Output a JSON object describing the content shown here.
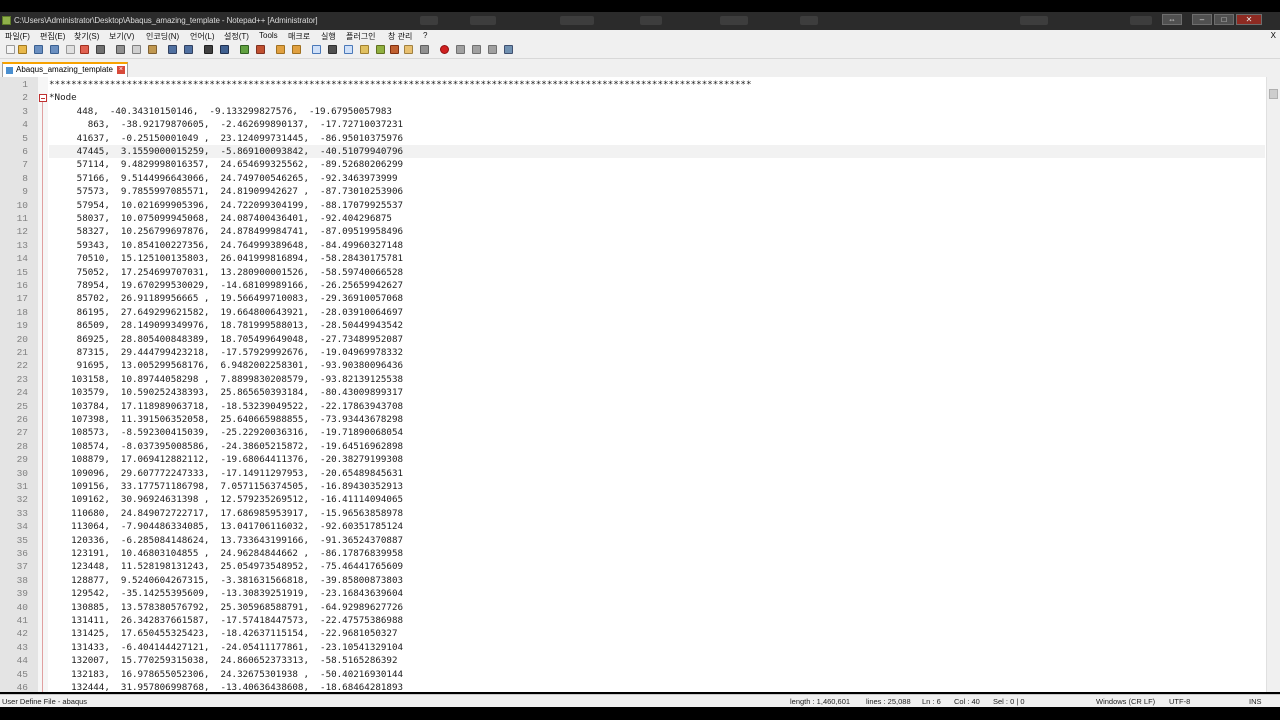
{
  "window": {
    "title": "C:\\Users\\Administrator\\Desktop\\Abaqus_amazing_template - Notepad++ [Administrator]"
  },
  "menu": [
    "파일(F)",
    "편집(E)",
    "찾기(S)",
    "보기(V)",
    "인코딩(N)",
    "언어(L)",
    "설정(T)",
    "Tools",
    "매크로",
    "실행",
    "플러그인",
    "창 관리",
    "?"
  ],
  "menu_close": "X",
  "tab": {
    "label": "Abaqus_amazing_template"
  },
  "editor": {
    "lines": [
      {
        "n": "1",
        "t": "*******************************************************************************************************************************"
      },
      {
        "n": "2",
        "t": "*Node"
      },
      {
        "n": "3",
        "t": "     448,  -40.34310150146,  -9.133299827576,  -19.67950057983"
      },
      {
        "n": "4",
        "t": "       863,  -38.92179870605,  -2.462699890137,  -17.72710037231"
      },
      {
        "n": "5",
        "t": "     41637,  -0.25150001049 ,  23.124099731445,  -86.95010375976"
      },
      {
        "n": "6",
        "t": "     47445,  3.1559000015259,  -5.869100093842,  -40.51079940796"
      },
      {
        "n": "7",
        "t": "     57114,  9.4829998016357,  24.654699325562,  -89.52680206299"
      },
      {
        "n": "8",
        "t": "     57166,  9.5144996643066,  24.749700546265,  -92.3463973999"
      },
      {
        "n": "9",
        "t": "     57573,  9.7855997085571,  24.81909942627 ,  -87.73010253906"
      },
      {
        "n": "10",
        "t": "     57954,  10.021699905396,  24.722099304199,  -88.17079925537"
      },
      {
        "n": "11",
        "t": "     58037,  10.075099945068,  24.087400436401,  -92.404296875"
      },
      {
        "n": "12",
        "t": "     58327,  10.256799697876,  24.878499984741,  -87.09519958496"
      },
      {
        "n": "13",
        "t": "     59343,  10.854100227356,  24.764999389648,  -84.49960327148"
      },
      {
        "n": "14",
        "t": "     70510,  15.125100135803,  26.041999816894,  -58.28430175781"
      },
      {
        "n": "15",
        "t": "     75052,  17.254699707031,  13.280900001526,  -58.59740066528"
      },
      {
        "n": "16",
        "t": "     78954,  19.670299530029,  -14.68109989166,  -26.25659942627"
      },
      {
        "n": "17",
        "t": "     85702,  26.91189956665 ,  19.566499710083,  -29.36910057068"
      },
      {
        "n": "18",
        "t": "     86195,  27.649299621582,  19.664800643921,  -28.03910064697"
      },
      {
        "n": "19",
        "t": "     86509,  28.149099349976,  18.781999588013,  -28.50449943542"
      },
      {
        "n": "20",
        "t": "     86925,  28.805400848389,  18.705499649048,  -27.73489952087"
      },
      {
        "n": "21",
        "t": "     87315,  29.444799423218,  -17.57929992676,  -19.04969978332"
      },
      {
        "n": "22",
        "t": "     91695,  13.005299568176,  6.9482002258301,  -93.90380096436"
      },
      {
        "n": "23",
        "t": "    103158,  10.89744058298 ,  7.8899830208579,  -93.82139125538"
      },
      {
        "n": "24",
        "t": "    103579,  10.590252438393,  25.865650393184,  -80.43009899317"
      },
      {
        "n": "25",
        "t": "    103784,  17.118989063718,  -18.53239049522,  -22.17863943708"
      },
      {
        "n": "26",
        "t": "    107398,  11.391506352058,  25.640665988855,  -73.93443678298"
      },
      {
        "n": "27",
        "t": "    108573,  -8.592300415039,  -25.22920036316,  -19.71890068054"
      },
      {
        "n": "28",
        "t": "    108574,  -8.037395008586,  -24.38605215872,  -19.64516962898"
      },
      {
        "n": "29",
        "t": "    108879,  17.069412882112,  -19.68064411376,  -20.38279199308"
      },
      {
        "n": "30",
        "t": "    109096,  29.607772247333,  -17.14911297953,  -20.65489845631"
      },
      {
        "n": "31",
        "t": "    109156,  33.177571186798,  7.0571156374505,  -16.89430352913"
      },
      {
        "n": "32",
        "t": "    109162,  30.96924631398 ,  12.579235269512,  -16.41114094065"
      },
      {
        "n": "33",
        "t": "    110680,  24.849072722717,  17.686985953917,  -15.96563858978"
      },
      {
        "n": "34",
        "t": "    113064,  -7.904486334085,  13.041706116032,  -92.60351785124"
      },
      {
        "n": "35",
        "t": "    120336,  -6.285084148624,  13.733643199166,  -91.36524370887"
      },
      {
        "n": "36",
        "t": "    123191,  10.46803104855 ,  24.96284844662 ,  -86.17876839958"
      },
      {
        "n": "37",
        "t": "    123448,  11.528198131243,  25.054973548952,  -75.46441765609"
      },
      {
        "n": "38",
        "t": "    128877,  9.5240604267315,  -3.381631566818,  -39.85800873803"
      },
      {
        "n": "39",
        "t": "    129542,  -35.14255395609,  -13.30839251919,  -23.16843639604"
      },
      {
        "n": "40",
        "t": "    130885,  13.578380576792,  25.305968588791,  -64.92989627726"
      },
      {
        "n": "41",
        "t": "    131411,  26.342837661587,  -17.57418447573,  -22.47575386988"
      },
      {
        "n": "42",
        "t": "    131425,  17.650455325423,  -18.42637115154,  -22.9681050327"
      },
      {
        "n": "43",
        "t": "    131433,  -6.404144427121,  -24.05411177861,  -23.10541329104"
      },
      {
        "n": "44",
        "t": "    132007,  15.770259315038,  24.860652373313,  -58.5165286392"
      },
      {
        "n": "45",
        "t": "    132183,  16.978655052306,  24.32675301938 ,  -50.40216930144"
      },
      {
        "n": "46",
        "t": "    132444,  31.957806998768,  -13.40636438608,  -18.68464281893"
      }
    ]
  },
  "status": {
    "file_type": "User Define File - abaqus",
    "length": "length : 1,460,601",
    "lines": "lines : 25,088",
    "ln": "Ln : 6",
    "col": "Col : 40",
    "sel": "Sel : 0 | 0",
    "eol": "Windows (CR LF)",
    "encoding": "UTF-8",
    "ins": "INS"
  }
}
